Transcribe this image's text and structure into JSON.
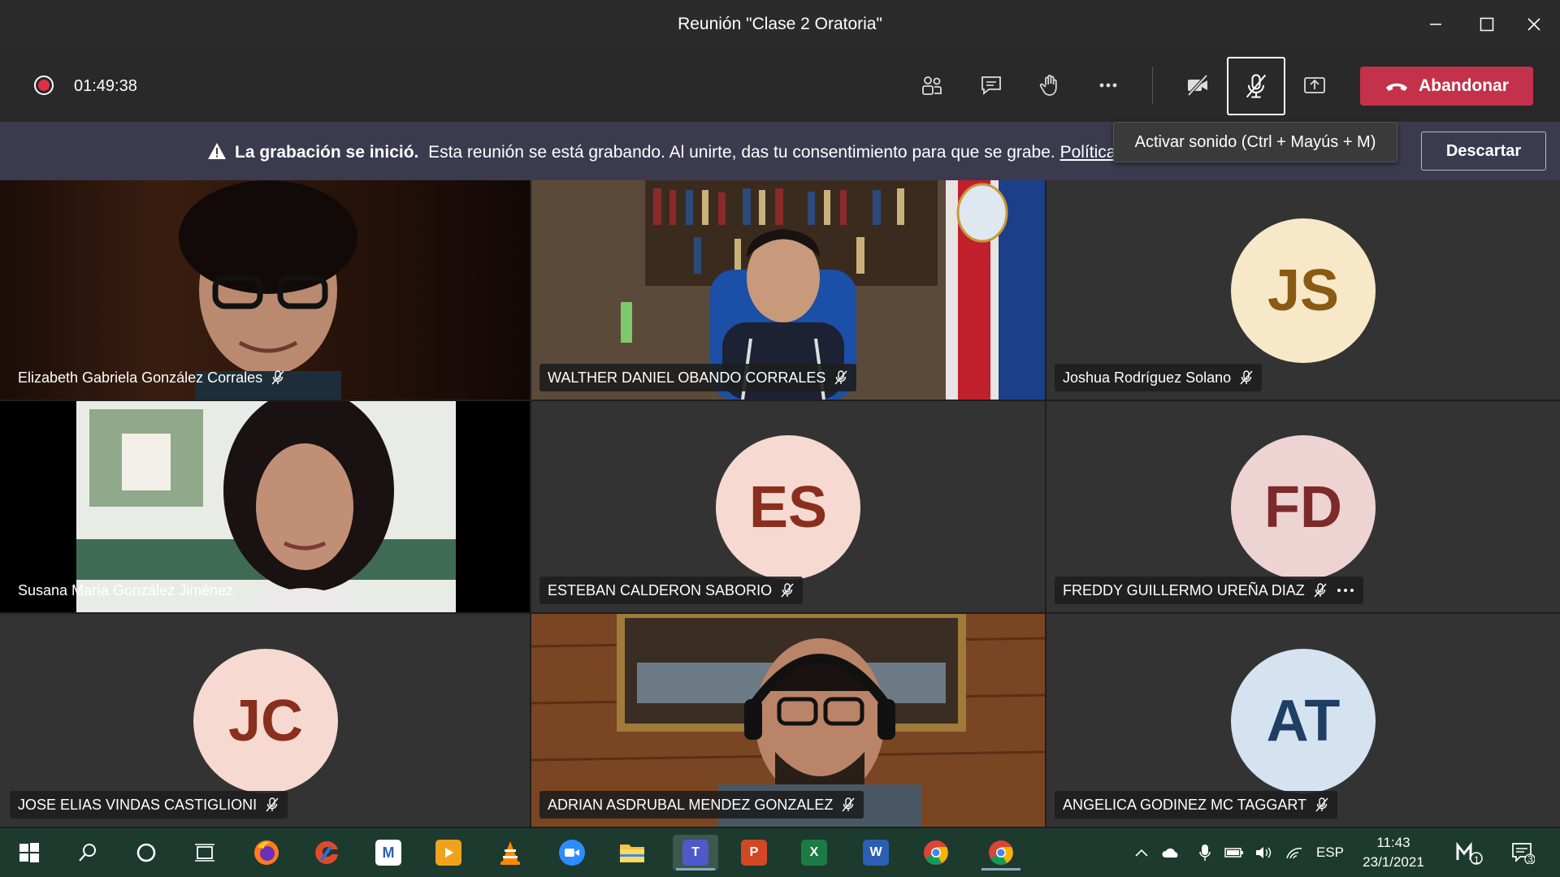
{
  "window": {
    "title": "Reunión \"Clase 2 Oratoria\""
  },
  "toolbar": {
    "timer": "01:49:38",
    "leave_label": "Abandonar",
    "leave_color": "#c4314b"
  },
  "banner": {
    "title": "La grabación se inició.",
    "message": "Esta reunión se está grabando. Al unirte, das tu consentimiento para que se grabe.",
    "link": "Política d",
    "dismiss_label": "Descartar"
  },
  "tooltip": {
    "text": "Activar sonido (Ctrl + Mayús + M)"
  },
  "participants": [
    {
      "name": "Elizabeth Gabriela González Corrales",
      "video": true,
      "muted": true
    },
    {
      "name": "WALTHER DANIEL OBANDO CORRALES",
      "video": true,
      "muted": true
    },
    {
      "name": "Joshua Rodríguez Solano",
      "initials": "JS",
      "avatar_bg": "#f7e9c8",
      "avatar_fg": "#8a5a14",
      "muted": true
    },
    {
      "name": "Susana María González Jiménez",
      "video": true,
      "muted": false
    },
    {
      "name": "ESTEBAN CALDERON SABORIO",
      "initials": "ES",
      "avatar_bg": "#f6d9d0",
      "avatar_fg": "#8a2e1e",
      "muted": true
    },
    {
      "name": "FREDDY GUILLERMO UREÑA DIAZ",
      "initials": "FD",
      "avatar_bg": "#eed3d3",
      "avatar_fg": "#7c2a2a",
      "muted": true,
      "more": true
    },
    {
      "name": "JOSE ELIAS VINDAS CASTIGLIONI",
      "initials": "JC",
      "avatar_bg": "#f6d9d0",
      "avatar_fg": "#8a2e1e",
      "muted": true
    },
    {
      "name": "ADRIAN ASDRUBAL MENDEZ GONZALEZ",
      "video": true,
      "muted": true
    },
    {
      "name": "ANGELICA GODINEZ MC TAGGART",
      "initials": "AT",
      "avatar_bg": "#d5e3f0",
      "avatar_fg": "#1f3e63",
      "muted": true
    }
  ],
  "taskbar": {
    "language": "ESP",
    "time": "11:43",
    "date": "23/1/2021",
    "notification_count": "3",
    "app_badge": "1"
  }
}
